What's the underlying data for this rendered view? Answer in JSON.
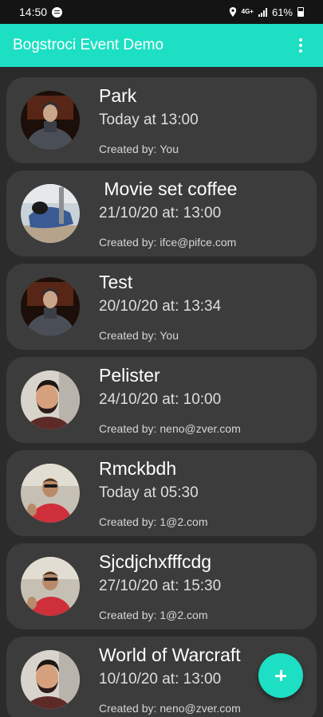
{
  "status_bar": {
    "time": "14:50",
    "network": "4G+",
    "battery": "61%"
  },
  "app_bar": {
    "title": "Bogstroci Event Demo",
    "menu_icon": "more-vert-icon"
  },
  "creator_label": "Created by:",
  "events": [
    {
      "title": "Park",
      "date": "Today at 13:00",
      "creator": "You",
      "avatar": "avatar-hoodie-brick"
    },
    {
      "title": " Movie set coffee",
      "date": "21/10/20 at: 13:00",
      "creator": "ifce@pifce.com",
      "avatar": "avatar-lying-blue"
    },
    {
      "title": "Test",
      "date": "20/10/20 at: 13:34",
      "creator": "You",
      "avatar": "avatar-hoodie-brick"
    },
    {
      "title": "Pelister",
      "date": "24/10/20 at: 10:00",
      "creator": "neno@zver.com",
      "avatar": "avatar-beard"
    },
    {
      "title": "Rmckbdh",
      "date": "Today at 05:30",
      "creator": "1@2.com",
      "avatar": "avatar-red-shirt"
    },
    {
      "title": "Sjcdjchxfffcdg",
      "date": "27/10/20 at: 15:30",
      "creator": "1@2.com",
      "avatar": "avatar-red-shirt"
    },
    {
      "title": "World of Warcraft",
      "date": "10/10/20 at: 13:00",
      "creator": "neno@zver.com",
      "avatar": "avatar-beard"
    }
  ],
  "fab": {
    "icon": "plus-icon"
  },
  "colors": {
    "accent": "#1ddfc3",
    "background": "#2b2b2b",
    "card": "#3c3c3c"
  }
}
